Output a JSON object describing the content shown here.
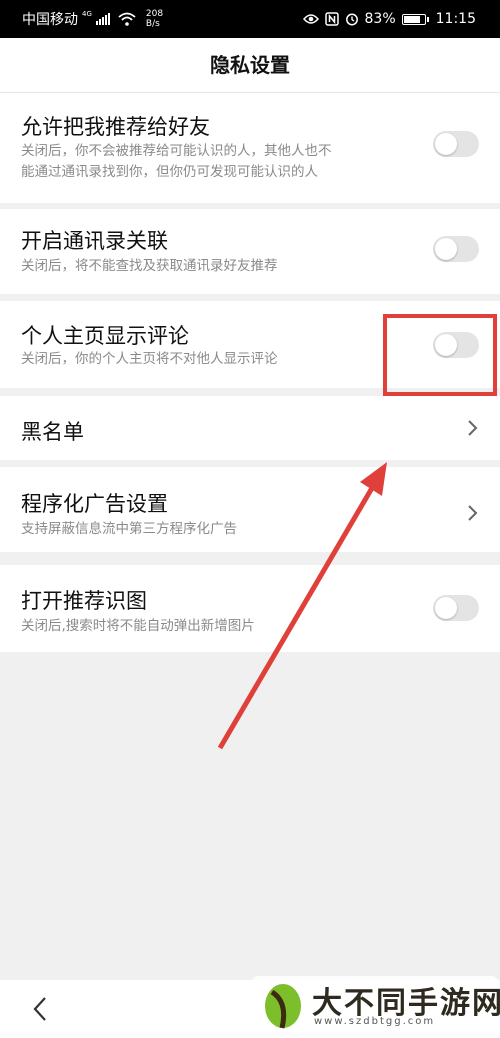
{
  "status_bar": {
    "carrier": "中国移动",
    "network_type": "4G",
    "speed_value": "208",
    "speed_unit": "B/s",
    "battery": "83%",
    "battery_level": 0.83,
    "time": "11:15",
    "icons": [
      "signal-icon",
      "wifi-icon",
      "eye-icon",
      "nfc-icon",
      "alarm-icon",
      "battery-icon"
    ]
  },
  "header": {
    "title": "隐私设置"
  },
  "settings": [
    {
      "title": "允许把我推荐给好友",
      "desc_line1": "关闭后，你不会被推荐给可能认识的人，其他人也不",
      "desc_line2": "能通过通讯录找到你，但你仍可发现可能认识的人",
      "control": "toggle",
      "on": false
    },
    {
      "title": "开启通讯录关联",
      "desc_line1": "关闭后，将不能查找及获取通讯录好友推荐",
      "control": "toggle",
      "on": false
    },
    {
      "title": "个人主页显示评论",
      "desc_line1": "关闭后，你的个人主页将不对他人显示评论",
      "control": "toggle",
      "on": false
    },
    {
      "title": "黑名单",
      "control": "chevron"
    },
    {
      "title": "程序化广告设置",
      "desc_line1": "支持屏蔽信息流中第三方程序化广告",
      "control": "chevron"
    },
    {
      "title": "打开推荐识图",
      "desc_line1": "关闭后,搜索时将不能自动弹出新增图片",
      "control": "toggle",
      "on": false
    }
  ],
  "annotation": {
    "color": "#e0403a"
  },
  "watermark": {
    "text": "大不同手游网",
    "url": "www.szdbtgg.com"
  },
  "colors": {
    "toggle_off": "#e4e4e4",
    "background": "#f0f0f0",
    "desc_text": "#8a8a8a"
  }
}
